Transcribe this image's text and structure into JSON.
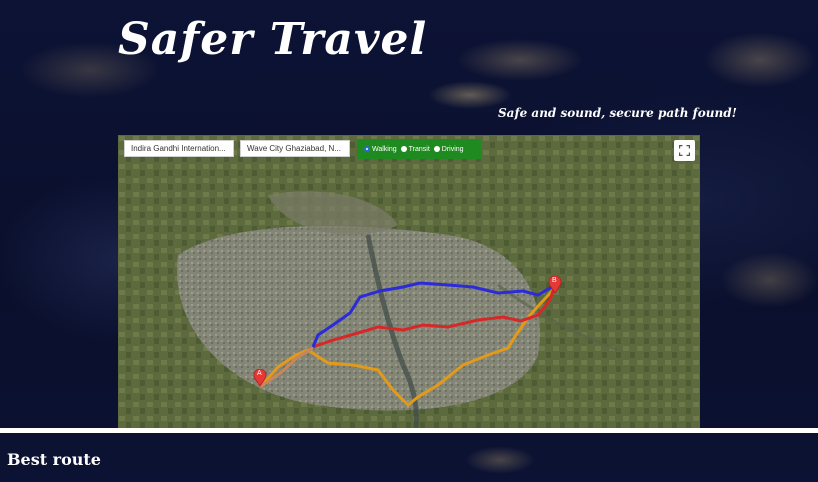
{
  "header": {
    "title": "Safer Travel",
    "subtitle": "Safe and sound, secure path found!"
  },
  "map": {
    "origin_input": "Indira Gandhi Internation...",
    "destination_input": "Wave City Ghaziabad, N...",
    "travel_modes": [
      "Walking",
      "Transit",
      "Driving"
    ],
    "selected_mode": "Walking",
    "marker_a": "A",
    "marker_b": "B",
    "route_colors": {
      "blue": "#2b2bd9",
      "red": "#d62828",
      "orange": "#e29a1a"
    }
  },
  "section": {
    "heading": "Best route"
  },
  "icons": {
    "fullscreen": "fullscreen-icon",
    "marker": "map-pin-icon"
  }
}
